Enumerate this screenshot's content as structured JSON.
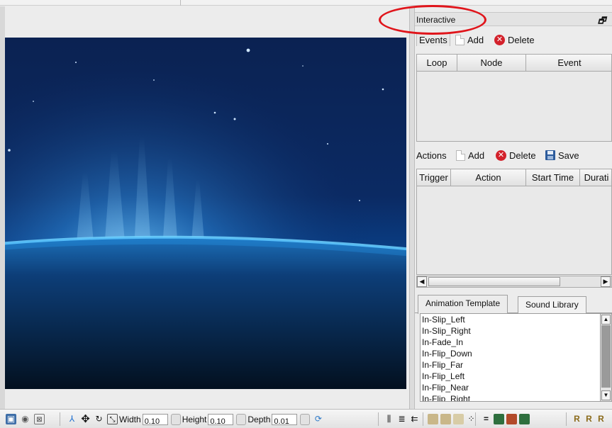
{
  "panel": {
    "title": "Interactive",
    "restore_glyph": "🗗"
  },
  "events": {
    "tab_label": "Events",
    "add_label": "Add",
    "delete_label": "Delete",
    "columns": [
      "Loop",
      "Node",
      "Event"
    ]
  },
  "actions": {
    "label": "Actions",
    "add_label": "Add",
    "delete_label": "Delete",
    "save_label": "Save",
    "columns": [
      "Trigger",
      "Action",
      "Start Time",
      "Durati"
    ]
  },
  "library_tabs": [
    "Animation Template",
    "Sound Library"
  ],
  "animation_templates": [
    "In-Slip_Left",
    "In-Slip_Right",
    "In-Fade_In",
    "In-Flip_Down",
    "In-Flip_Far",
    "In-Flip_Left",
    "In-Flip_Near",
    "In-Flip_Right"
  ],
  "bottom_toolbar": {
    "width_label": "Width",
    "width_value": "0.10",
    "height_label": "Height",
    "height_value": "0.10",
    "depth_label": "Depth",
    "depth_value": "0.01",
    "right_letters": [
      "R",
      "R",
      "R"
    ]
  },
  "colors": {
    "highlight_ring": "#e0151b",
    "delete_icon": "#d3212b",
    "earth_glow": "#3fb6ff"
  }
}
